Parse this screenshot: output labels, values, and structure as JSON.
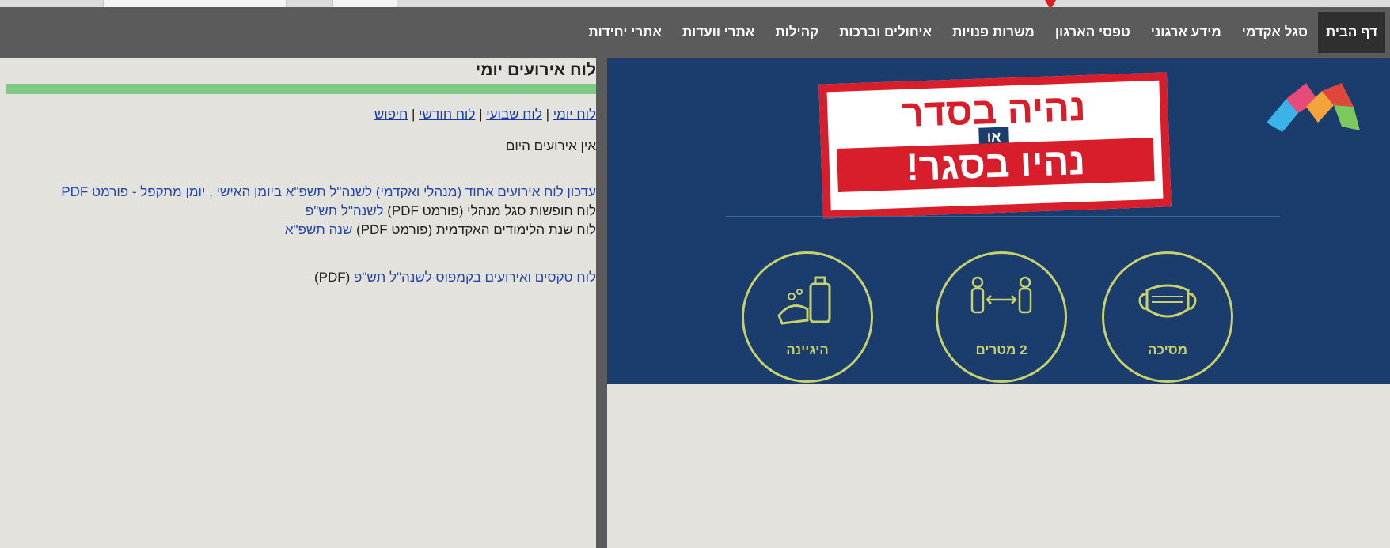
{
  "nav": {
    "items": [
      "דף הבית",
      "סגל אקדמי",
      "מידע ארגוני",
      "טפסי הארגון",
      "משרות פנויות",
      "איחולים וברכות",
      "קהילות",
      "אתרי וועדות",
      "אתרי יחידות"
    ]
  },
  "events": {
    "title": "לוח אירועים יומי",
    "link_daily": "לוח יומי",
    "link_weekly": "לוח שבועי",
    "link_monthly": "לוח חודשי",
    "link_search": "חיפוש",
    "separator": " | ",
    "no_events": "אין אירועים היום",
    "line1": "עדכון לוח אירועים אחוד (מנהלי ואקדמי) לשנה\"ל תשפ\"א ביומן האישי , יומן מתקפל - פורמט PDF",
    "line2_prefix": "לוח חופשות סגל מנהלי (פורמט PDF) ",
    "line2_link": "לשנה\"ל תש\"פ",
    "line3_prefix": "לוח שנת הלימודים האקדמית (פורמט PDF) ",
    "line3_link": "שנה תשפ\"א",
    "line4_link": "לוח טקסים ואירועים בקמפוס לשנה\"ל תש\"פ",
    "line4_suffix": " (PDF)"
  },
  "banner": {
    "sign_line1": "נהיה בסדר",
    "sign_or": "או",
    "sign_line2": "נהיו בסגר!",
    "icons": [
      {
        "name": "hygiene-icon",
        "caption": "היגיינה"
      },
      {
        "name": "distance-icon",
        "caption": "2 מטרים"
      },
      {
        "name": "mask-icon",
        "caption": "מסיכה"
      }
    ],
    "colors": {
      "bg": "#1a3d6e",
      "accent": "#c8d16b",
      "sign_red": "#d81e2a"
    }
  }
}
